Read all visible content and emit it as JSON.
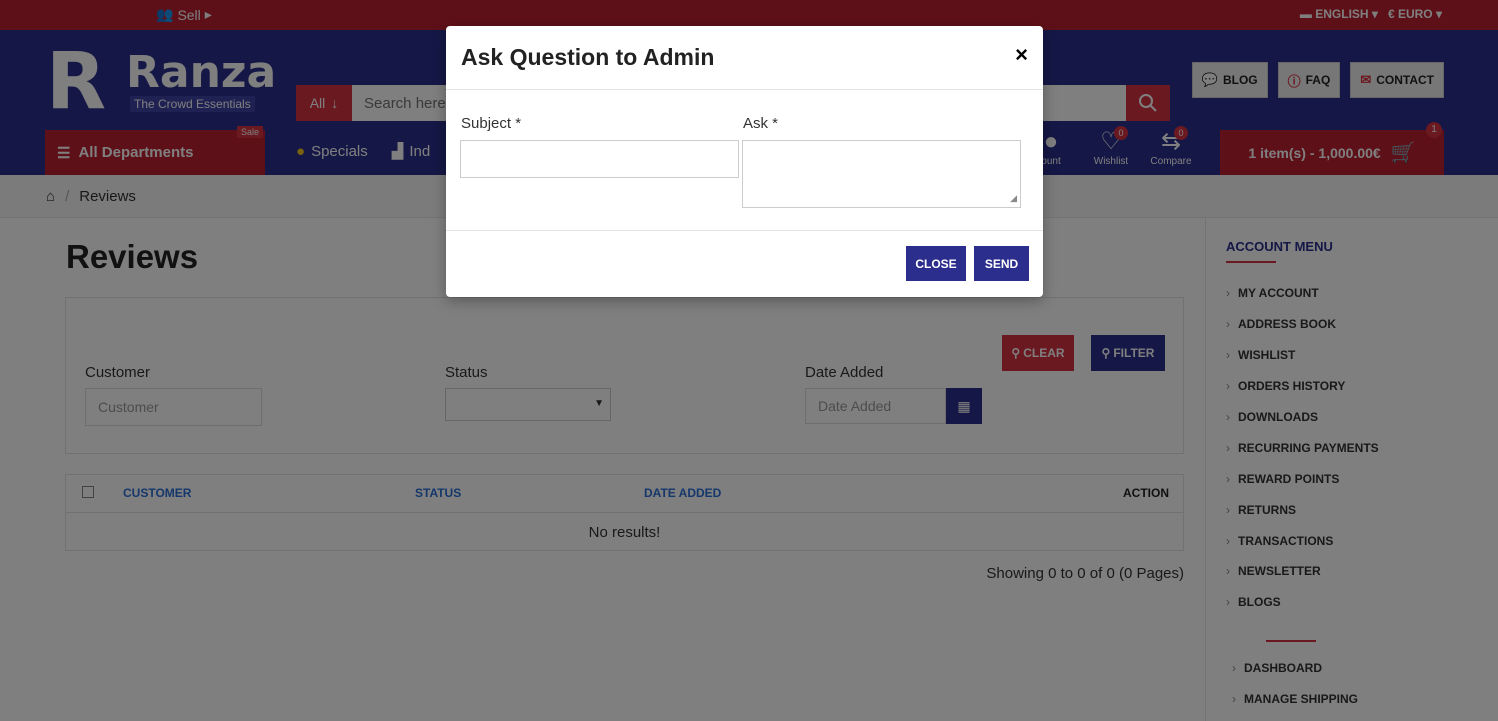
{
  "topbar": {
    "sell_label": "Sell",
    "language": "ENGLISH",
    "currency": "€ EURO"
  },
  "brand": {
    "letter": "R",
    "name": "Ranza",
    "tagline": "The Crowd Essentials"
  },
  "search": {
    "category": "All",
    "placeholder": "Search here"
  },
  "toplinks": {
    "blog": "BLOG",
    "faq": "FAQ",
    "contact": "CONTACT"
  },
  "nav": {
    "departments": "All Departments",
    "sale_badge": "Sale",
    "specials": "Specials",
    "industries": "Ind"
  },
  "icons": {
    "account": "ount",
    "wishlist": "Wishlist",
    "wishlist_count": "0",
    "compare": "Compare",
    "compare_count": "0"
  },
  "cart": {
    "summary": "1 item(s) - 1,000.00€",
    "count": "1"
  },
  "breadcrumb": {
    "current": "Reviews"
  },
  "page": {
    "title": "Reviews"
  },
  "filters": {
    "clear_label": "CLEAR",
    "filter_label": "FILTER",
    "customer_label": "Customer",
    "customer_placeholder": "Customer",
    "status_label": "Status",
    "date_label": "Date Added",
    "date_placeholder": "Date Added"
  },
  "table": {
    "columns": [
      "CUSTOMER",
      "STATUS",
      "DATE ADDED",
      "ACTION"
    ],
    "empty_message": "No results!",
    "showing": "Showing 0 to 0 of 0 (0 Pages)"
  },
  "sidebar": {
    "title": "ACCOUNT MENU",
    "items": [
      "MY ACCOUNT",
      "ADDRESS BOOK",
      "WISHLIST",
      "ORDERS HISTORY",
      "DOWNLOADS",
      "RECURRING PAYMENTS",
      "REWARD POINTS",
      "RETURNS",
      "TRANSACTIONS",
      "NEWSLETTER",
      "BLOGS"
    ],
    "seller_items": [
      "DASHBOARD",
      "MANAGE SHIPPING"
    ]
  },
  "modal": {
    "title": "Ask Question to Admin",
    "close_glyph": "×",
    "subject_label": "Subject *",
    "ask_label": "Ask *",
    "close_button": "CLOSE",
    "send_button": "SEND"
  },
  "colors": {
    "brand_red": "#bd2130",
    "accent_red": "#d63242",
    "brand_navy": "#2b2e8c",
    "link_blue": "#2b6fd6"
  }
}
